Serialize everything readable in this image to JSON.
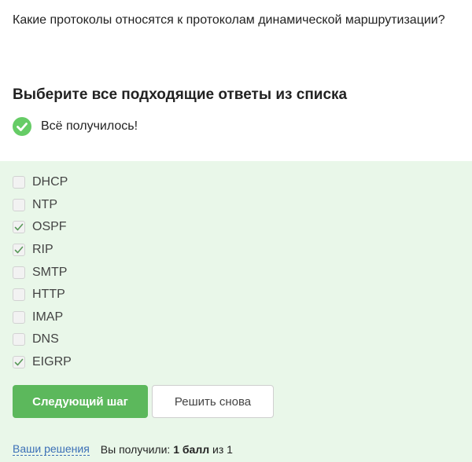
{
  "question": "Какие протоколы относятся к протоколам динамической маршрутизации?",
  "instruction": "Выберите все подходящие ответы из списка",
  "status": {
    "icon": "check-circle-icon",
    "text": "Всё получилось!",
    "color": "#66cc66"
  },
  "options": [
    {
      "label": "DHCP",
      "checked": false
    },
    {
      "label": "NTP",
      "checked": false
    },
    {
      "label": "OSPF",
      "checked": true
    },
    {
      "label": "RIP",
      "checked": true
    },
    {
      "label": "SMTP",
      "checked": false
    },
    {
      "label": "HTTP",
      "checked": false
    },
    {
      "label": "IMAP",
      "checked": false
    },
    {
      "label": "DNS",
      "checked": false
    },
    {
      "label": "EIGRP",
      "checked": true
    }
  ],
  "buttons": {
    "next": "Следующий шаг",
    "retry": "Решить снова"
  },
  "footer": {
    "solutions_link": "Ваши решения",
    "score_prefix": "Вы получили: ",
    "score_value": "1 балл",
    "score_suffix": " из 1"
  },
  "colors": {
    "accent": "#5cb85c",
    "answers_background": "#e9f7e9",
    "link": "#3b6fb6"
  }
}
